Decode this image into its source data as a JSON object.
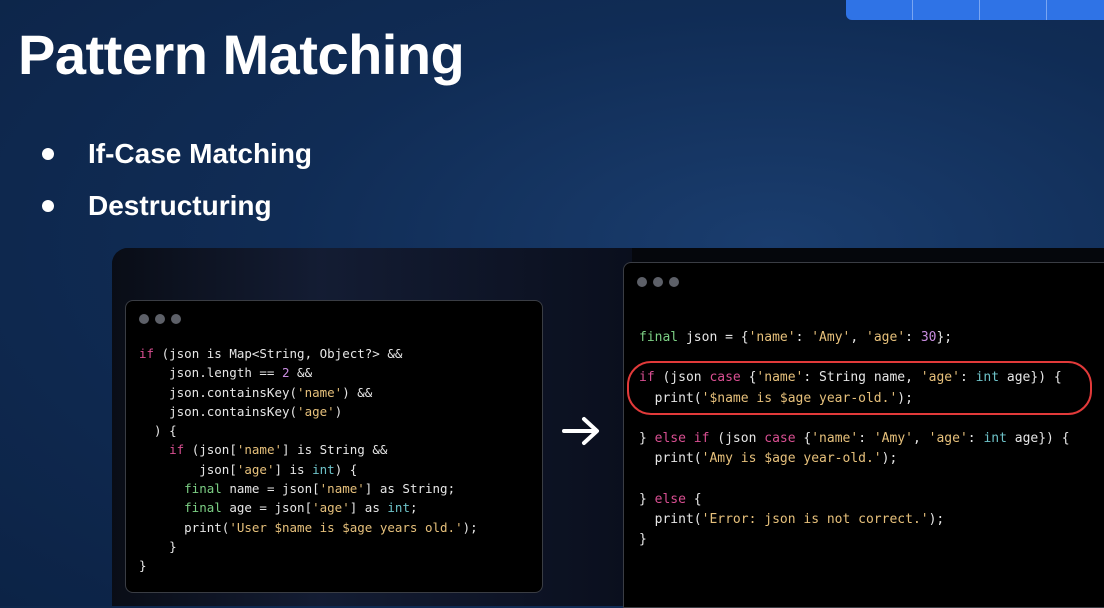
{
  "slide": {
    "title": "Pattern Matching",
    "bullets": [
      "If-Case Matching",
      "Destructuring"
    ]
  },
  "colors": {
    "background": "#102c55",
    "keyword": "#d94f92",
    "number": "#c98de0",
    "string": "#e6c07b",
    "type": "#6ec3c9",
    "final_keyword": "#7ccf84",
    "highlight_outline": "#e23a3a"
  },
  "icons": {
    "arrow": "right-arrow-icon",
    "window_controls": "window-dots-icon"
  },
  "left_code": [
    [
      [
        "k",
        "if"
      ],
      [
        "p",
        " (json is Map<String, Object?> &&"
      ]
    ],
    [
      [
        "p",
        "    json.length == "
      ],
      [
        "n",
        "2"
      ],
      [
        "p",
        " &&"
      ]
    ],
    [
      [
        "p",
        "    json.containsKey("
      ],
      [
        "s",
        "'name'"
      ],
      [
        "p",
        ") &&"
      ]
    ],
    [
      [
        "p",
        "    json.containsKey("
      ],
      [
        "s",
        "'age'"
      ],
      [
        "p",
        ")"
      ]
    ],
    [
      [
        "p",
        "  ) {"
      ]
    ],
    [
      [
        "p",
        "    "
      ],
      [
        "k",
        "if"
      ],
      [
        "p",
        " (json["
      ],
      [
        "s",
        "'name'"
      ],
      [
        "p",
        "] is String &&"
      ]
    ],
    [
      [
        "p",
        "        json["
      ],
      [
        "s",
        "'age'"
      ],
      [
        "p",
        "] is "
      ],
      [
        "t",
        "int"
      ],
      [
        "p",
        ") {"
      ]
    ],
    [
      [
        "p",
        "      "
      ],
      [
        "f",
        "final"
      ],
      [
        "p",
        " name = json["
      ],
      [
        "s",
        "'name'"
      ],
      [
        "p",
        "] as String;"
      ]
    ],
    [
      [
        "p",
        "      "
      ],
      [
        "f",
        "final"
      ],
      [
        "p",
        " age = json["
      ],
      [
        "s",
        "'age'"
      ],
      [
        "p",
        "] as "
      ],
      [
        "t",
        "int"
      ],
      [
        "p",
        ";"
      ]
    ],
    [
      [
        "p",
        "      print("
      ],
      [
        "s",
        "'User $name is $age years old.'"
      ],
      [
        "p",
        ");"
      ]
    ],
    [
      [
        "p",
        "    }"
      ]
    ],
    [
      [
        "p",
        "}"
      ]
    ]
  ],
  "right_code": [
    [
      [
        "f",
        "final"
      ],
      [
        "p",
        " json = {"
      ],
      [
        "s",
        "'name'"
      ],
      [
        "p",
        ": "
      ],
      [
        "s",
        "'Amy'"
      ],
      [
        "p",
        ", "
      ],
      [
        "s",
        "'age'"
      ],
      [
        "p",
        ": "
      ],
      [
        "n",
        "30"
      ],
      [
        "p",
        "};"
      ]
    ],
    [
      [
        "p",
        ""
      ]
    ],
    [
      [
        "k",
        "if"
      ],
      [
        "p",
        " (json "
      ],
      [
        "k",
        "case"
      ],
      [
        "p",
        " {"
      ],
      [
        "s",
        "'name'"
      ],
      [
        "p",
        ": String name, "
      ],
      [
        "s",
        "'age'"
      ],
      [
        "p",
        ": "
      ],
      [
        "t",
        "int"
      ],
      [
        "p",
        " age}) {"
      ]
    ],
    [
      [
        "p",
        "  print("
      ],
      [
        "s",
        "'$name is $age year-old.'"
      ],
      [
        "p",
        ");"
      ]
    ],
    [
      [
        "p",
        ""
      ]
    ],
    [
      [
        "p",
        "} "
      ],
      [
        "k",
        "else if"
      ],
      [
        "p",
        " (json "
      ],
      [
        "k",
        "case"
      ],
      [
        "p",
        " {"
      ],
      [
        "s",
        "'name'"
      ],
      [
        "p",
        ": "
      ],
      [
        "s",
        "'Amy'"
      ],
      [
        "p",
        ", "
      ],
      [
        "s",
        "'age'"
      ],
      [
        "p",
        ": "
      ],
      [
        "t",
        "int"
      ],
      [
        "p",
        " age}) {"
      ]
    ],
    [
      [
        "p",
        "  print("
      ],
      [
        "s",
        "'Amy is $age year-old.'"
      ],
      [
        "p",
        ");"
      ]
    ],
    [
      [
        "p",
        ""
      ]
    ],
    [
      [
        "p",
        "} "
      ],
      [
        "k",
        "else"
      ],
      [
        "p",
        " {"
      ]
    ],
    [
      [
        "p",
        "  print("
      ],
      [
        "s",
        "'Error: json is not correct.'"
      ],
      [
        "p",
        ");"
      ]
    ],
    [
      [
        "p",
        "}"
      ]
    ]
  ]
}
